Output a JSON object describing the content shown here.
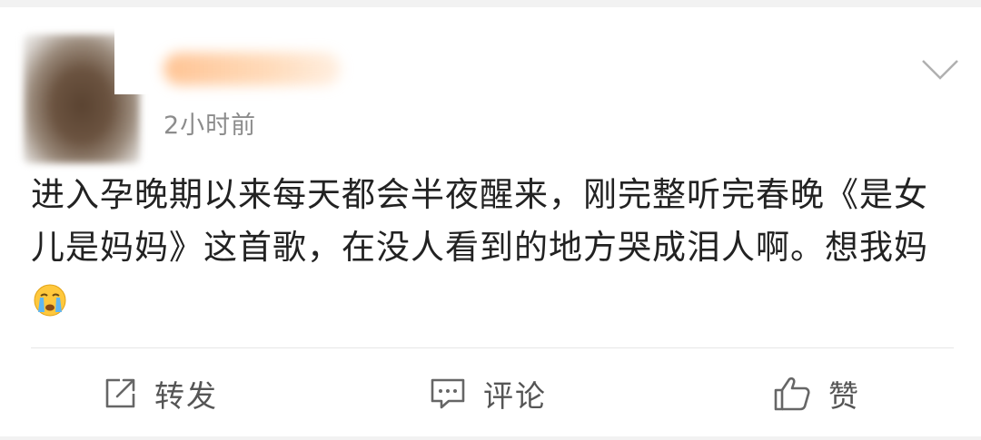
{
  "post": {
    "timestamp": "2小时前",
    "text": "进入孕晚期以来每天都会半夜醒来，刚完整听完春晚《是女儿是妈妈》这首歌，在没人看到的地方哭成泪人啊。想我妈",
    "emoji": "crying-face-emoji"
  },
  "header": {
    "menu_icon": "chevron-down-icon"
  },
  "actions": {
    "repost_label": "转发",
    "repost_icon": "share-icon",
    "comment_label": "评论",
    "comment_icon": "comment-icon",
    "like_label": "赞",
    "like_icon": "thumbs-up-icon"
  },
  "colors": {
    "text": "#222222",
    "meta": "#8c8c8c",
    "action": "#555555",
    "background": "#f2f2f2"
  }
}
